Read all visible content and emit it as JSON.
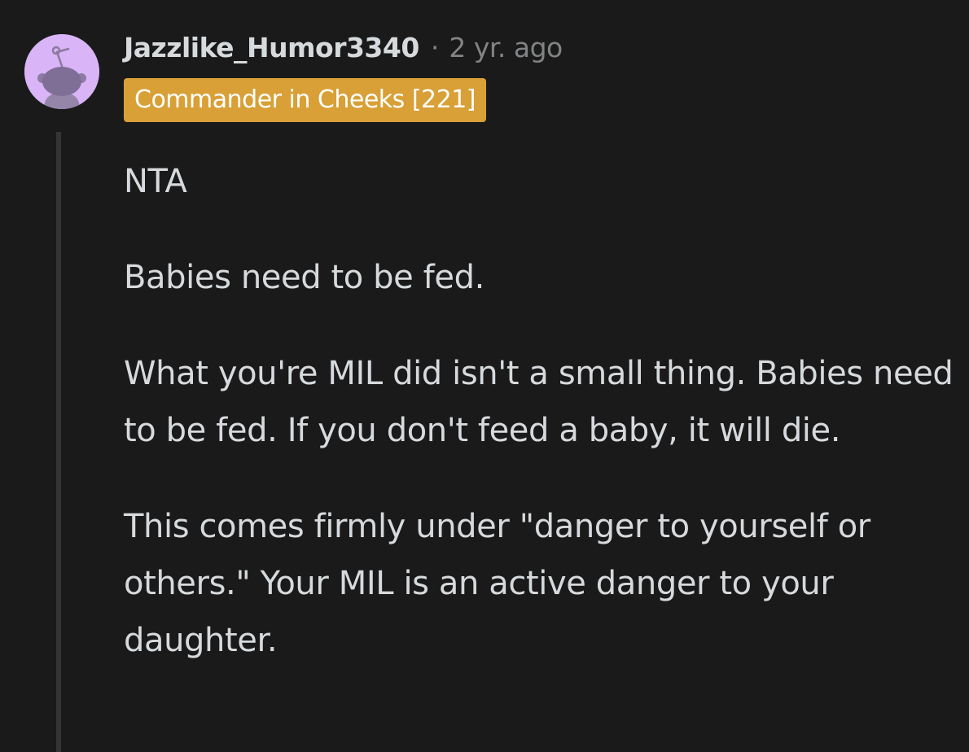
{
  "comment": {
    "author": "Jazzlike_Humor3340",
    "separator": "·",
    "timestamp": "2 yr. ago",
    "flair": "Commander in Cheeks [221]",
    "paragraphs": [
      "NTA",
      "Babies need to be fed.",
      "What you're MIL did isn't a small thing. Babies need to be fed. If you don't feed a baby, it will die.",
      "This comes firmly under \"danger to yourself or others.\" Your MIL is an active danger to your daughter."
    ]
  },
  "icons": {
    "avatar": "snoo-avatar-icon"
  },
  "colors": {
    "background": "#1a1a1b",
    "text": "#d7dadc",
    "muted": "#818384",
    "flair_bg": "#d8a036",
    "avatar_bg": "#d9b4f7",
    "thread_line": "#343536"
  }
}
